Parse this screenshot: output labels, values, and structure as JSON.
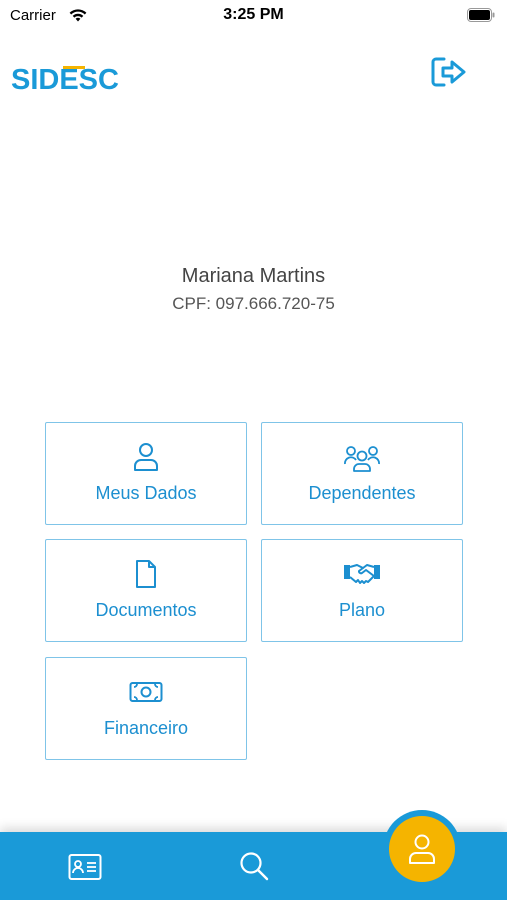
{
  "status_bar": {
    "carrier": "Carrier",
    "time": "3:25 PM"
  },
  "header": {
    "logo_text": "SIDESC",
    "logout_icon": "logout-icon"
  },
  "profile": {
    "name": "Mariana Martins",
    "cpf": "CPF: 097.666.720-75"
  },
  "menu": [
    {
      "label": "Meus Dados",
      "icon": "user-icon"
    },
    {
      "label": "Dependentes",
      "icon": "group-icon"
    },
    {
      "label": "Documentos",
      "icon": "document-icon"
    },
    {
      "label": "Plano",
      "icon": "handshake-icon"
    },
    {
      "label": "Financeiro",
      "icon": "money-icon"
    }
  ],
  "tabbar": {
    "items": [
      "id-card-icon",
      "search-icon",
      "profile-icon"
    ]
  },
  "colors": {
    "primary": "#1a9ad8",
    "tile_text": "#1c8fd0",
    "tile_border": "#7fc4e8",
    "accent": "#f5b400",
    "logo_bar": "#f5b400"
  }
}
